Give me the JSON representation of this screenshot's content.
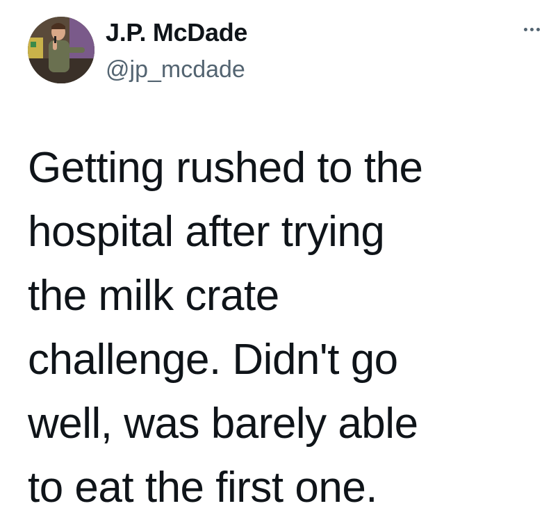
{
  "author": {
    "display_name": "J.P. McDade",
    "handle": "@jp_mcdade",
    "avatar_icon": "profile-photo-comedian-on-stage"
  },
  "menu": {
    "icon": "more-dots-icon"
  },
  "tweet": {
    "lines": [
      "Getting rushed to the",
      "hospital after trying",
      "the milk crate",
      "challenge. Didn't go",
      "well, was barely able",
      "to eat the first one."
    ]
  },
  "colors": {
    "text_primary": "#0f1419",
    "text_secondary": "#536471",
    "background": "#ffffff"
  }
}
